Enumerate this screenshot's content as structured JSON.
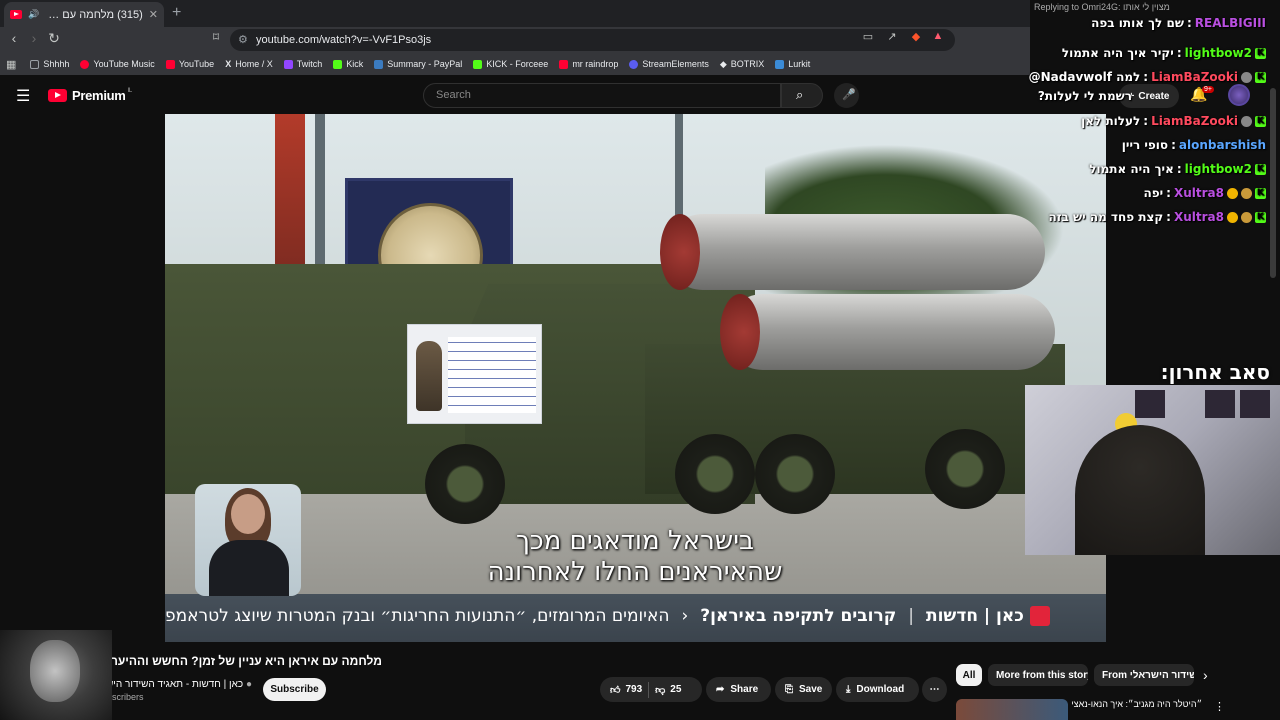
{
  "browser": {
    "tab_title": "(315) מלחמה עם איראן היא ע",
    "url": "youtube.com/watch?v=-VvF1Pso3js",
    "bookmarks": [
      {
        "label": "Shhhh",
        "color": "#9aa0a6"
      },
      {
        "label": "YouTube Music",
        "color": "#ff0033"
      },
      {
        "label": "YouTube",
        "color": "#ff0033"
      },
      {
        "label": "Home / X",
        "color": "#e8eaed"
      },
      {
        "label": "Twitch",
        "color": "#9146ff"
      },
      {
        "label": "Kick",
        "color": "#53fc18"
      },
      {
        "label": "Summary - PayPal",
        "color": "#3b7bbf"
      },
      {
        "label": "KICK - Forceee",
        "color": "#53fc18"
      },
      {
        "label": "mr raindrop",
        "color": "#ff0033"
      },
      {
        "label": "StreamElements",
        "color": "#5a5df0"
      },
      {
        "label": "BOTRIX",
        "color": "#e8eaed"
      },
      {
        "label": "Lurkit",
        "color": "#3b8bd6"
      }
    ]
  },
  "youtube": {
    "logo_text": "Premium",
    "logo_region": "IL",
    "search_placeholder": "Search",
    "create_label": "Create",
    "notif_count": "9+"
  },
  "video": {
    "subtitle_line1": "בישראל מודאגים מכך",
    "subtitle_line2": "שהאיראנים החלו לאחרונה",
    "ticker_brand": "כאן | חדשות",
    "ticker_bold": "קרובים לתקיפה באיראן?",
    "ticker_text": "האיומים המרומזים, ״התנועות החריגות״ ובנק המטרות שיוצג לטראמפ",
    "title": "מלחמה עם איראן היא עניין של זמן? החשש וההיערכות",
    "channel": "כאן | חדשות - תאגיד השידור הישראלי",
    "subscribers": "scribers",
    "subscribe_label": "Subscribe",
    "likes": "793",
    "dislikes": "25",
    "share_label": "Share",
    "save_label": "Save",
    "download_label": "Download"
  },
  "related": {
    "chips": [
      "All",
      "More from this story",
      "From השידור הישראלי"
    ],
    "first_title": "״היטלר היה מגניב״: איך הנאו-נאצים"
  },
  "stream_chat": {
    "replying": "Replying to Omri24G: מצוין לי אותו",
    "messages": [
      {
        "user": "REALBIGIII",
        "text": "שם לך אותו בפה",
        "color": "#b94fe0"
      },
      {
        "user": "lightbow2",
        "text": "יקיר איך היה אתמול",
        "color": "#53fc18"
      },
      {
        "user": "LiamBaZooki",
        "text": "@Nadavwolf למה",
        "color": "#ff4a5e"
      },
      {
        "user": "",
        "text": "רשמת לי לעלות?",
        "color": "#ffffff"
      },
      {
        "user": "LiamBaZooki",
        "text": "לעלות לאן",
        "color": "#ff4a5e"
      },
      {
        "user": "alonbarshish",
        "text": "סופי ריין",
        "color": "#5aa6ff"
      },
      {
        "user": "lightbow2",
        "text": "איך היה אתמול",
        "color": "#53fc18"
      },
      {
        "user": "Xultra8",
        "text": "יפה",
        "color": "#b94fe0"
      },
      {
        "user": "Xultra8",
        "text": "קצת פחד מה יש בזה",
        "color": "#b94fe0"
      }
    ],
    "last_sub_caption": "סאב אחרון: mr_chines"
  }
}
